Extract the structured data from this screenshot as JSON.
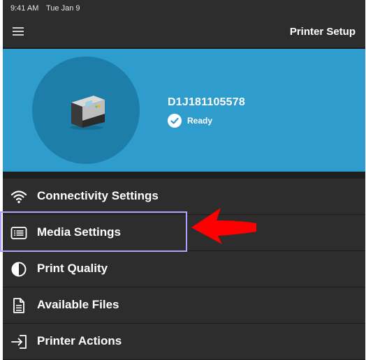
{
  "status_bar": {
    "time": "9:41 AM",
    "date": "Tue Jan 9"
  },
  "nav": {
    "title": "Printer Setup",
    "menu_icon": "hamburger-icon"
  },
  "printer": {
    "serial": "D1J181105578",
    "status": "Ready",
    "status_icon": "check-circle-icon"
  },
  "menu": {
    "items": [
      {
        "label": "Connectivity Settings",
        "icon": "wifi-icon"
      },
      {
        "label": "Media Settings",
        "icon": "media-list-icon"
      },
      {
        "label": "Print Quality",
        "icon": "half-circle-contrast-icon"
      },
      {
        "label": "Available Files",
        "icon": "document-icon"
      },
      {
        "label": "Printer Actions",
        "icon": "enter-arrow-icon"
      }
    ]
  },
  "annotation": {
    "highlight_color": "#a9a3ff",
    "arrow_color": "#ff0000"
  },
  "colors": {
    "hero_bg": "#2e9ccc",
    "hero_circle": "#1c7ea9",
    "screen_bg": "#2d2d2d"
  }
}
